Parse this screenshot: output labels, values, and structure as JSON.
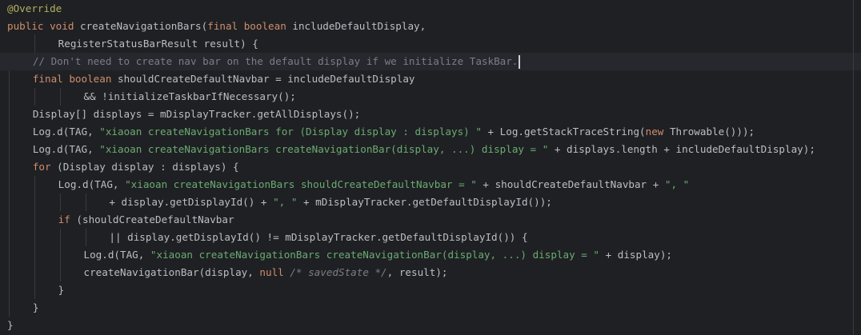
{
  "editor": {
    "colors": {
      "background": "#1f2023",
      "current_line": "#26282e",
      "keyword": "#cf8e6d",
      "string": "#6aab73",
      "comment": "#7a7e85",
      "annotation": "#b3ae60",
      "plain": "#bcbec4"
    },
    "lines": [
      {
        "indent": 0,
        "tokens": [
          [
            "annotation",
            "@Override"
          ]
        ]
      },
      {
        "indent": 0,
        "tokens": [
          [
            "keyword",
            "public void "
          ],
          [
            "plain",
            "createNavigationBars("
          ],
          [
            "keyword",
            "final boolean "
          ],
          [
            "plain",
            "includeDefaultDisplay,"
          ]
        ]
      },
      {
        "indent": 8,
        "tokens": [
          [
            "plain",
            "RegisterStatusBarResult result) {"
          ]
        ]
      },
      {
        "indent": 4,
        "current": true,
        "caret": true,
        "tokens": [
          [
            "comment",
            "// Don't need to create nav bar on the default display if we initialize TaskBar."
          ]
        ]
      },
      {
        "indent": 4,
        "tokens": [
          [
            "keyword",
            "final boolean "
          ],
          [
            "plain",
            "shouldCreateDefaultNavbar = includeDefaultDisplay"
          ]
        ]
      },
      {
        "indent": 12,
        "tokens": [
          [
            "plain",
            "&& !initializeTaskbarIfNecessary();"
          ]
        ]
      },
      {
        "indent": 4,
        "tokens": [
          [
            "plain",
            "Display[] displays = mDisplayTracker.getAllDisplays();"
          ]
        ]
      },
      {
        "indent": 4,
        "tokens": [
          [
            "plain",
            "Log.d(TAG, "
          ],
          [
            "string",
            "\"xiaoan createNavigationBars for (Display display : displays) \""
          ],
          [
            "plain",
            " + Log.getStackTraceString("
          ],
          [
            "keyword",
            "new "
          ],
          [
            "plain",
            "Throwable()));"
          ]
        ]
      },
      {
        "indent": 4,
        "tokens": [
          [
            "plain",
            "Log.d(TAG, "
          ],
          [
            "string",
            "\"xiaoan createNavigationBars createNavigationBar(display, ...) display = \""
          ],
          [
            "plain",
            " + displays.length + includeDefaultDisplay);"
          ]
        ]
      },
      {
        "indent": 4,
        "tokens": [
          [
            "keyword",
            "for "
          ],
          [
            "plain",
            "(Display display : displays) {"
          ]
        ]
      },
      {
        "indent": 8,
        "tokens": [
          [
            "plain",
            "Log.d(TAG, "
          ],
          [
            "string",
            "\"xiaoan createNavigationBars shouldCreateDefaultNavbar = \""
          ],
          [
            "plain",
            " + shouldCreateDefaultNavbar + "
          ],
          [
            "string",
            "\", \""
          ]
        ]
      },
      {
        "indent": 16,
        "tokens": [
          [
            "plain",
            "+ display.getDisplayId() + "
          ],
          [
            "string",
            "\", \""
          ],
          [
            "plain",
            " + mDisplayTracker.getDefaultDisplayId());"
          ]
        ]
      },
      {
        "indent": 8,
        "tokens": [
          [
            "keyword",
            "if "
          ],
          [
            "plain",
            "(shouldCreateDefaultNavbar"
          ]
        ]
      },
      {
        "indent": 16,
        "tokens": [
          [
            "plain",
            "|| display.getDisplayId() != mDisplayTracker.getDefaultDisplayId()) {"
          ]
        ]
      },
      {
        "indent": 12,
        "tokens": [
          [
            "plain",
            "Log.d(TAG, "
          ],
          [
            "string",
            "\"xiaoan createNavigationBars createNavigationBar(display, ...) display = \""
          ],
          [
            "plain",
            " + display);"
          ]
        ]
      },
      {
        "indent": 12,
        "tokens": [
          [
            "plain",
            "createNavigationBar(display, "
          ],
          [
            "keyword",
            "null "
          ],
          [
            "comment-italic",
            "/* savedState */"
          ],
          [
            "plain",
            ", result);"
          ]
        ]
      },
      {
        "indent": 8,
        "tokens": [
          [
            "plain",
            "}"
          ]
        ]
      },
      {
        "indent": 4,
        "tokens": [
          [
            "plain",
            "}"
          ]
        ]
      },
      {
        "indent": 0,
        "tokens": [
          [
            "plain",
            "}"
          ]
        ]
      }
    ]
  }
}
